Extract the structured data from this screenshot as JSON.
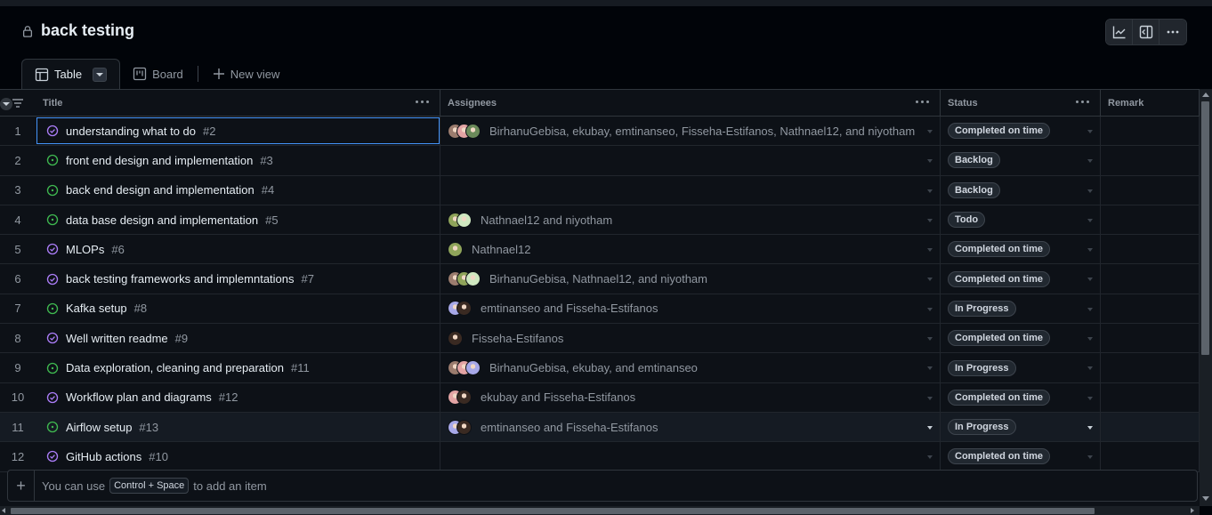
{
  "project": {
    "title": "back testing",
    "visibility_icon": "lock-icon"
  },
  "header_buttons": [
    {
      "name": "insights-button",
      "icon": "graph-icon"
    },
    {
      "name": "sidebar-toggle-button",
      "icon": "sidebar-expand-icon"
    },
    {
      "name": "more-options-button",
      "icon": "kebab-horizontal-icon"
    }
  ],
  "tabs": [
    {
      "label": "Table",
      "icon": "table-icon",
      "active": true
    },
    {
      "label": "Board",
      "icon": "project-board-icon",
      "active": false
    }
  ],
  "new_view_label": "New view",
  "columns": {
    "title": "Title",
    "assignees": "Assignees",
    "status": "Status",
    "remark": "Remark"
  },
  "colors": {
    "accent_blue": "#4493f8",
    "open_green": "#3fb950",
    "done_purple": "#ab7df8",
    "background": "#0d1117"
  },
  "rows": [
    {
      "num": "1",
      "title": "understanding what to do",
      "issue": "#2",
      "state": "done",
      "assignees": "BirhanuGebisa, ekubay, emtinanseo, Fisseha-Estifanos, Nathnael12, and niyotham",
      "avatars": [
        "#9b7c6e",
        "#e3a4a4",
        "#6b8a5a"
      ],
      "status": "Completed on time"
    },
    {
      "num": "2",
      "title": "front end design and implementation",
      "issue": "#3",
      "state": "open",
      "assignees": "",
      "avatars": [],
      "status": "Backlog"
    },
    {
      "num": "3",
      "title": "back end design and implementation",
      "issue": "#4",
      "state": "open",
      "assignees": "",
      "avatars": [],
      "status": "Backlog"
    },
    {
      "num": "4",
      "title": "data base design and implementation",
      "issue": "#5",
      "state": "open",
      "assignees": "Nathnael12 and niyotham",
      "avatars": [
        "#8fa45a",
        "#cfe8c0"
      ],
      "status": "Todo"
    },
    {
      "num": "5",
      "title": "MLOPs",
      "issue": "#6",
      "state": "done",
      "assignees": "Nathnael12",
      "avatars": [
        "#8fa45a"
      ],
      "status": "Completed on time"
    },
    {
      "num": "6",
      "title": "back testing frameworks and implemntations",
      "issue": "#7",
      "state": "done",
      "assignees": "BirhanuGebisa, Nathnael12, and niyotham",
      "avatars": [
        "#9b7c6e",
        "#8fa45a",
        "#cfe8c0"
      ],
      "status": "Completed on time"
    },
    {
      "num": "7",
      "title": "Kafka setup",
      "issue": "#8",
      "state": "open",
      "assignees": "emtinanseo and Fisseha-Estifanos",
      "avatars": [
        "#a7a8e8",
        "#3a2a22"
      ],
      "status": "In Progress"
    },
    {
      "num": "8",
      "title": "Well written readme",
      "issue": "#9",
      "state": "done",
      "assignees": "Fisseha-Estifanos",
      "avatars": [
        "#3a2a22"
      ],
      "status": "Completed on time"
    },
    {
      "num": "9",
      "title": "Data exploration, cleaning and preparation",
      "issue": "#11",
      "state": "open",
      "assignees": "BirhanuGebisa, ekubay, and emtinanseo",
      "avatars": [
        "#9b7c6e",
        "#e3a4a4",
        "#a7a8e8"
      ],
      "status": "In Progress"
    },
    {
      "num": "10",
      "title": "Workflow plan and diagrams",
      "issue": "#12",
      "state": "done",
      "assignees": "ekubay and Fisseha-Estifanos",
      "avatars": [
        "#e3a4a4",
        "#3a2a22"
      ],
      "status": "Completed on time"
    },
    {
      "num": "11",
      "title": "Airflow setup",
      "issue": "#13",
      "state": "open",
      "assignees": "emtinanseo and Fisseha-Estifanos",
      "avatars": [
        "#a7a8e8",
        "#3a2a22"
      ],
      "status": "In Progress"
    },
    {
      "num": "12",
      "title": "GitHub actions",
      "issue": "#10",
      "state": "done",
      "assignees": "",
      "avatars": [],
      "status": "Completed on time"
    }
  ],
  "footer": {
    "hint_prefix": "You can use",
    "kbd": "Control + Space",
    "hint_suffix": "to add an item"
  }
}
